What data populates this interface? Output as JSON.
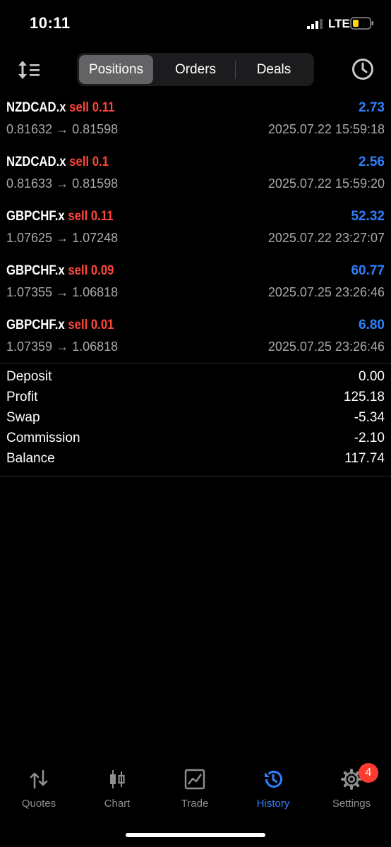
{
  "status": {
    "time": "10:11",
    "network": "LTE"
  },
  "segments": [
    "Positions",
    "Orders",
    "Deals"
  ],
  "positions": [
    {
      "symbol": "NZDCAD.x",
      "side": "sell 0.11",
      "profit": "2.73",
      "prices": "0.81632 → 0.81598",
      "date": "2025.07.22 15:59:18"
    },
    {
      "symbol": "NZDCAD.x",
      "side": "sell 0.1",
      "profit": "2.56",
      "prices": "0.81633 → 0.81598",
      "date": "2025.07.22 15:59:20"
    },
    {
      "symbol": "GBPCHF.x",
      "side": "sell 0.11",
      "profit": "52.32",
      "prices": "1.07625 → 1.07248",
      "date": "2025.07.22 23:27:07"
    },
    {
      "symbol": "GBPCHF.x",
      "side": "sell 0.09",
      "profit": "60.77",
      "prices": "1.07355 → 1.06818",
      "date": "2025.07.25 23:26:46"
    },
    {
      "symbol": "GBPCHF.x",
      "side": "sell 0.01",
      "profit": "6.80",
      "prices": "1.07359 → 1.06818",
      "date": "2025.07.25 23:26:46"
    }
  ],
  "summary": [
    {
      "label": "Deposit",
      "value": "0.00"
    },
    {
      "label": "Profit",
      "value": "125.18"
    },
    {
      "label": "Swap",
      "value": "-5.34"
    },
    {
      "label": "Commission",
      "value": "-2.10"
    },
    {
      "label": "Balance",
      "value": "117.74"
    }
  ],
  "tabs": [
    {
      "label": "Quotes",
      "icon": "quotes-icon"
    },
    {
      "label": "Chart",
      "icon": "chart-icon"
    },
    {
      "label": "Trade",
      "icon": "trade-icon"
    },
    {
      "label": "History",
      "icon": "history-icon"
    },
    {
      "label": "Settings",
      "icon": "gear-icon"
    }
  ],
  "settings_badge": "4",
  "colors": {
    "accent": "#2f80ff",
    "sell": "#ff453a",
    "badge": "#ff3b30",
    "battery": "#ffd60a"
  }
}
